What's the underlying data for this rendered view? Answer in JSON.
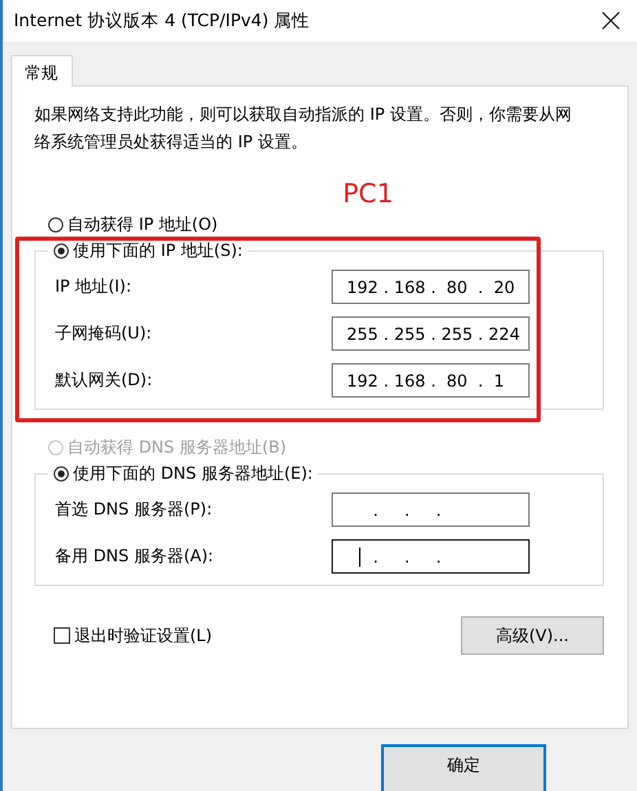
{
  "window": {
    "title": "Internet 协议版本 4 (TCP/IPv4) 属性"
  },
  "tabs": [
    {
      "label": "常规",
      "selected": true
    }
  ],
  "description": "如果网络支持此功能，则可以获取自动指派的 IP 设置。否则，你需要从网络系统管理员处获得适当的 IP 设置。",
  "annotation": {
    "label": "PC1"
  },
  "ip_section": {
    "auto_option": {
      "label": "自动获得 IP 地址(O)",
      "selected": false,
      "disabled": false
    },
    "manual_option": {
      "label": "使用下面的 IP 地址(S):",
      "selected": true,
      "disabled": false
    },
    "fields": [
      {
        "label": "IP 地址(I):",
        "value": "192 . 168 .  80  .  20",
        "focused": false
      },
      {
        "label": "子网掩码(U):",
        "value": "255 . 255 . 255 . 224",
        "focused": false
      },
      {
        "label": "默认网关(D):",
        "value": "192 . 168 .  80  .  1 ",
        "focused": false
      }
    ]
  },
  "dns_section": {
    "auto_option": {
      "label": "自动获得 DNS 服务器地址(B)",
      "selected": false,
      "disabled": true
    },
    "manual_option": {
      "label": "使用下面的 DNS 服务器地址(E):",
      "selected": true,
      "disabled": false
    },
    "fields": [
      {
        "label": "首选 DNS 服务器(P):",
        "value": "     .     .     .    ",
        "focused": false
      },
      {
        "label": "备用 DNS 服务器(A):",
        "value": "     .     .     .    ",
        "focused": true
      }
    ]
  },
  "validate_checkbox": {
    "label": "退出时验证设置(L)",
    "checked": false
  },
  "advanced_button": {
    "label": "高级(V)..."
  },
  "ok_button": {
    "label": "确定"
  }
}
